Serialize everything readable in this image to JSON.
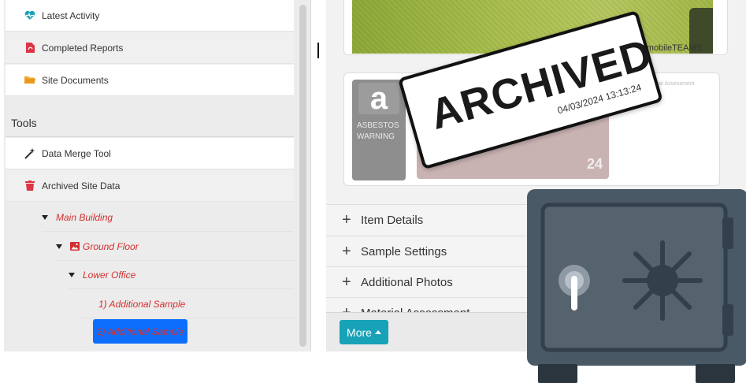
{
  "sidebar": {
    "items": [
      {
        "label": "Latest Activity",
        "icon": "heartbeat-icon",
        "color": "#17a2b8"
      },
      {
        "label": "Completed Reports",
        "icon": "pdf-file-icon",
        "color": "#dc3545"
      },
      {
        "label": "Site Documents",
        "icon": "folder-icon",
        "color": "#f0a832"
      }
    ],
    "tools_heading": "Tools",
    "tools": [
      {
        "label": "Data Merge Tool",
        "icon": "magic-wand-icon",
        "color": "#333333"
      },
      {
        "label": "Archived Site Data",
        "icon": "trash-icon",
        "color": "#dc3545"
      }
    ],
    "tree": {
      "building": "Main Building",
      "floor": "Ground Floor",
      "room": "Lower Office",
      "samples": [
        "1) Additional Sample",
        "2) Additional Sample"
      ],
      "selected_index": 1
    }
  },
  "main": {
    "photo_caption": "From mobileTEAMS",
    "thumbnails": {
      "warning_letter": "a",
      "warning_text": [
        "ASBESTOS",
        "WARNING"
      ],
      "material_title": "Material Assessment",
      "material_number": "24"
    },
    "accordion": [
      "Item Details",
      "Sample Settings",
      "Additional Photos",
      "Material Assessment"
    ],
    "more_button": "More"
  },
  "stamp": {
    "title": "ARCHIVED",
    "date": "04/03/2024 13:13:24"
  },
  "colors": {
    "accent_teal": "#17a2b8",
    "selected_blue": "#0d6efd",
    "tree_red": "#d32f2f",
    "safe_body": "#4a5966",
    "safe_dark": "#33404b"
  }
}
